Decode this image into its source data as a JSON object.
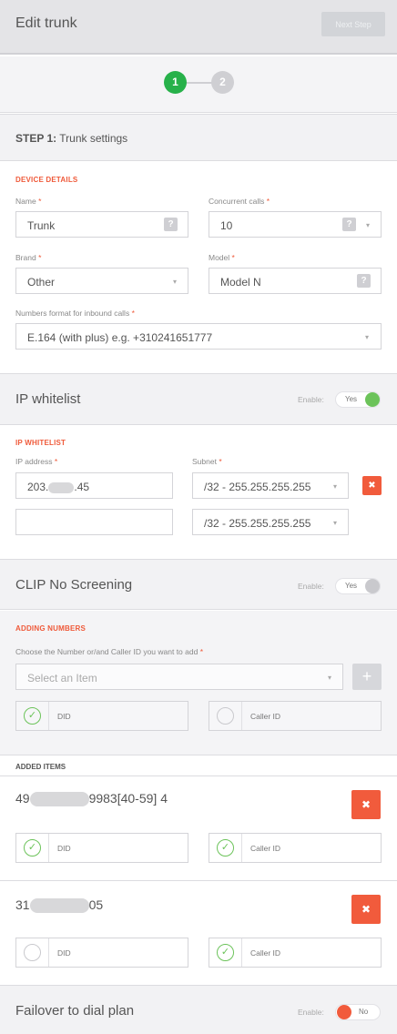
{
  "header": {
    "title": "Edit trunk",
    "next_step_label": "Next Step"
  },
  "steps": [
    {
      "number": "1",
      "active": true
    },
    {
      "number": "2",
      "active": false
    }
  ],
  "step1": {
    "prefix": "STEP 1:",
    "title": "Trunk settings"
  },
  "device_details": {
    "heading": "DEVICE DETAILS",
    "name": {
      "label": "Name",
      "value": "Trunk"
    },
    "concurrent_calls": {
      "label": "Concurrent calls",
      "value": "10"
    },
    "brand": {
      "label": "Brand",
      "value": "Other"
    },
    "model": {
      "label": "Model",
      "value": "Model N"
    },
    "numbers_format": {
      "label": "Numbers format for inbound calls",
      "value": "E.164 (with plus) e.g. +310241651777"
    }
  },
  "ip_whitelist": {
    "title": "IP whitelist",
    "enable_label": "Enable:",
    "toggle_value": "Yes",
    "heading": "IP WHITELIST",
    "ip_label": "IP address",
    "subnet_label": "Subnet",
    "rows": [
      {
        "ip_prefix": "203.",
        "ip_suffix": ".45",
        "subnet": "/32 - 255.255.255.255"
      },
      {
        "ip_prefix": "",
        "ip_suffix": "",
        "subnet": "/32 - 255.255.255.255"
      }
    ]
  },
  "clip": {
    "title": "CLIP No Screening",
    "enable_label": "Enable:",
    "toggle_value": "Yes",
    "heading": "ADDING NUMBERS",
    "choose_label": "Choose the Number or/and Caller ID you want to add",
    "select_placeholder": "Select an Item",
    "did_label": "DID",
    "caller_id_label": "Caller ID"
  },
  "added_items": {
    "heading": "ADDED ITEMS",
    "items": [
      {
        "prefix": "49",
        "suffix": "9983[40-59] 4",
        "did": true,
        "caller_id": true
      },
      {
        "prefix": "31",
        "suffix": "05",
        "did": false,
        "caller_id": true
      }
    ],
    "did_label": "DID",
    "caller_id_label": "Caller ID"
  },
  "failover": {
    "title": "Failover to dial plan",
    "enable_label": "Enable:",
    "toggle_value": "No"
  },
  "colors": {
    "accent_red": "#f15b3c",
    "active_green": "#27b14a",
    "toggle_green": "#6cc35a"
  },
  "icons": {
    "remove": "close-icon",
    "check": "check-icon",
    "help": "help-icon",
    "add": "plus-icon"
  }
}
